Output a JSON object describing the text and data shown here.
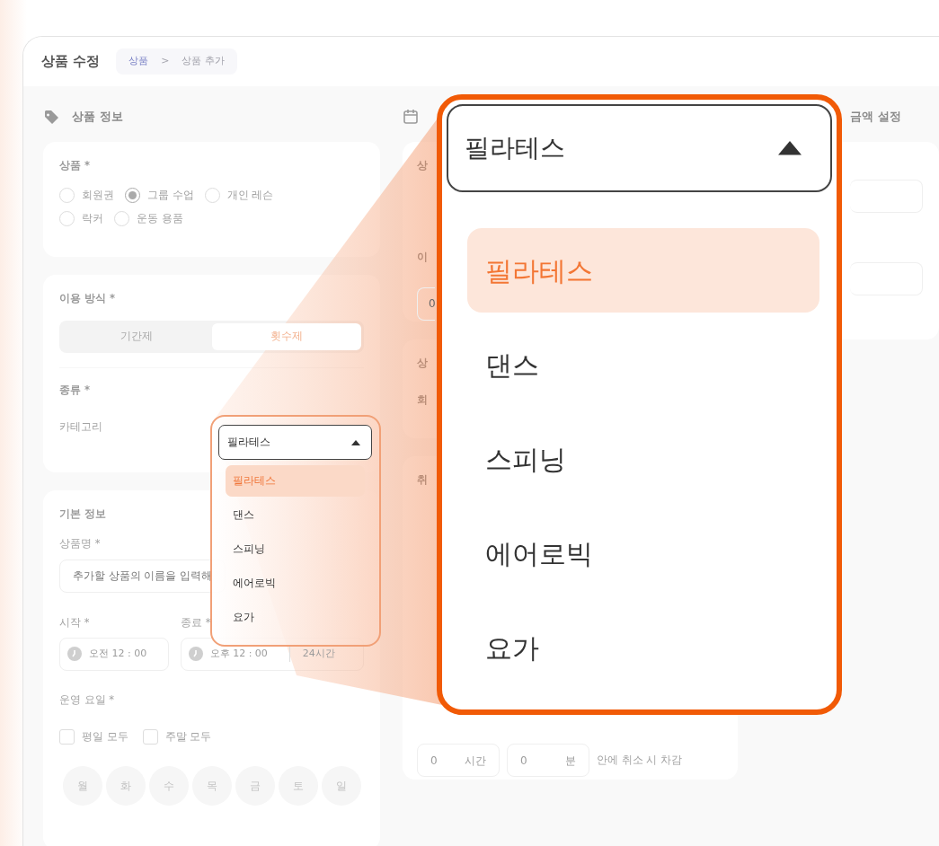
{
  "header": {
    "title": "상품 수정",
    "breadcrumb": [
      {
        "label": "상품",
        "kind": "link"
      },
      {
        "label": ">",
        "kind": "separator"
      },
      {
        "label": "상품 추가",
        "kind": "current"
      }
    ]
  },
  "left": {
    "section_title": "상품 정보",
    "product_card": {
      "label": "상품 *",
      "option_rows": [
        [
          {
            "label": "회원권",
            "selected": false
          },
          {
            "label": "그룹 수업",
            "selected": true
          },
          {
            "label": "개인 레슨",
            "selected": false
          }
        ],
        [
          {
            "label": "락커",
            "selected": false
          },
          {
            "label": "운동 용품",
            "selected": false
          }
        ]
      ]
    },
    "usage_card": {
      "label": "이용 방식 *",
      "segments": [
        {
          "label": "기간제",
          "selected": false
        },
        {
          "label": "횟수제",
          "selected": true
        }
      ],
      "type_label": "종류 *",
      "category_label": "카테고리"
    },
    "basic_card": {
      "title": "기본 정보",
      "name_label": "상품명 *",
      "name_placeholder": "추가할 상품의 이름을 입력해",
      "start_label": "시작 *",
      "start_time": "오전 12 : 00",
      "end_label": "종료 *",
      "end_time": "오후 12 : 00",
      "all_day": "24시간",
      "days_label": "운영 요일 *",
      "day_groups": [
        {
          "label": "평일 모두",
          "checked": false
        },
        {
          "label": "주말 모두",
          "checked": false
        }
      ],
      "days": [
        {
          "label": "월",
          "selected": false
        },
        {
          "label": "화",
          "selected": false
        },
        {
          "label": "수",
          "selected": false
        },
        {
          "label": "목",
          "selected": false
        },
        {
          "label": "금",
          "selected": false
        },
        {
          "label": "토",
          "selected": false
        },
        {
          "label": "일",
          "selected": false
        }
      ]
    }
  },
  "middle": {
    "cards": [
      {
        "items": [
          {
            "kind": "label",
            "text": "상"
          },
          {
            "kind": "field"
          },
          {
            "kind": "label",
            "text": "이"
          },
          {
            "kind": "field",
            "value": "0"
          }
        ]
      },
      {
        "items": [
          {
            "kind": "label",
            "text": "상"
          },
          {
            "kind": "label",
            "text": "회"
          }
        ]
      },
      {
        "items": [
          {
            "kind": "label",
            "text": "취"
          },
          {
            "kind": "field"
          },
          {
            "kind": "spacer"
          },
          {
            "kind": "cancel_row",
            "fields": [
              {
                "value": "0",
                "unit": "시간"
              },
              {
                "value": "0",
                "unit": "분"
              }
            ],
            "suffix": "안에 취소 시 차감"
          }
        ]
      }
    ]
  },
  "right": {
    "section_title": "금액 설정"
  },
  "dropdown_small": {
    "value": "필라테스",
    "options": [
      {
        "label": "필라테스",
        "selected": true
      },
      {
        "label": "댄스",
        "selected": false
      },
      {
        "label": "스피닝",
        "selected": false
      },
      {
        "label": "에어로빅",
        "selected": false
      },
      {
        "label": "요가",
        "selected": false
      }
    ]
  },
  "dropdown_zoom": {
    "value": "필라테스",
    "options": [
      {
        "label": "필라테스",
        "selected": true
      },
      {
        "label": "댄스",
        "selected": false
      },
      {
        "label": "스피닝",
        "selected": false
      },
      {
        "label": "에어로빅",
        "selected": false
      },
      {
        "label": "요가",
        "selected": false
      }
    ]
  }
}
